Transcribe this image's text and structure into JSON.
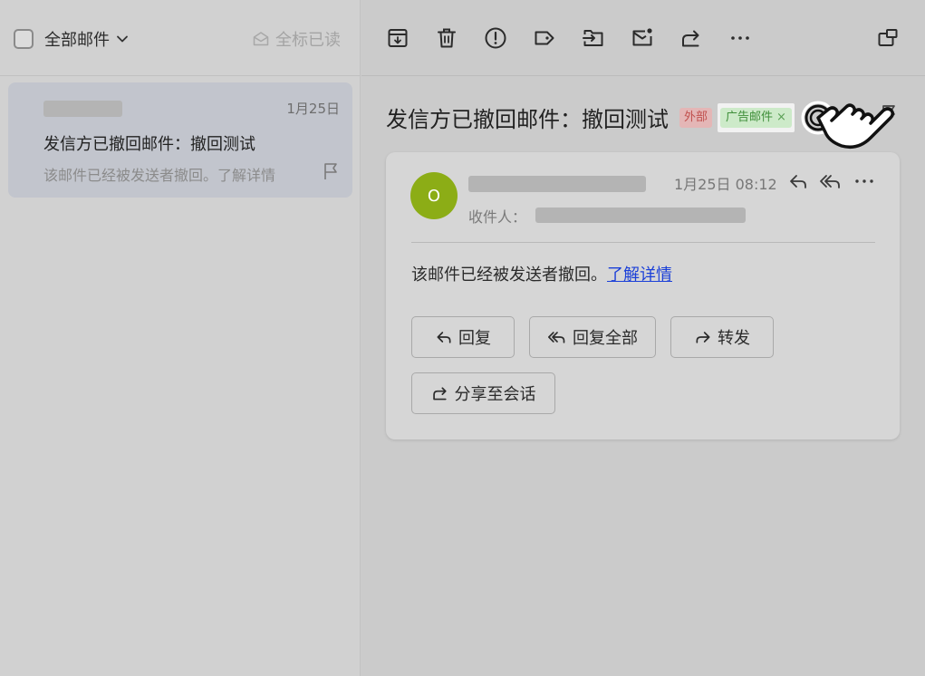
{
  "list_header": {
    "folder_label": "全部邮件",
    "mark_all_read_label": "全标已读"
  },
  "mail_list": [
    {
      "date": "1月25日",
      "subject": "发信方已撤回邮件：撤回测试",
      "preview": "该邮件已经被发送者撤回。了解详情"
    }
  ],
  "message": {
    "title": "发信方已撤回邮件：撤回测试",
    "tags": {
      "external": "外部",
      "ad": "广告邮件",
      "ad_remove": "×"
    },
    "avatar_letter": "O",
    "time": "1月25日 08:12",
    "recipient_label": "收件人：",
    "body_text": "该邮件已经被发送者撤回。",
    "body_link": "了解详情"
  },
  "actions": {
    "reply": "回复",
    "reply_all": "回复全部",
    "forward": "转发",
    "share_to_chat": "分享至会话"
  },
  "colors": {
    "avatar": "#8cad16",
    "link": "#1a3fd8",
    "tag_external_text": "#c0504d",
    "tag_ad_text": "#3f8f3a"
  }
}
